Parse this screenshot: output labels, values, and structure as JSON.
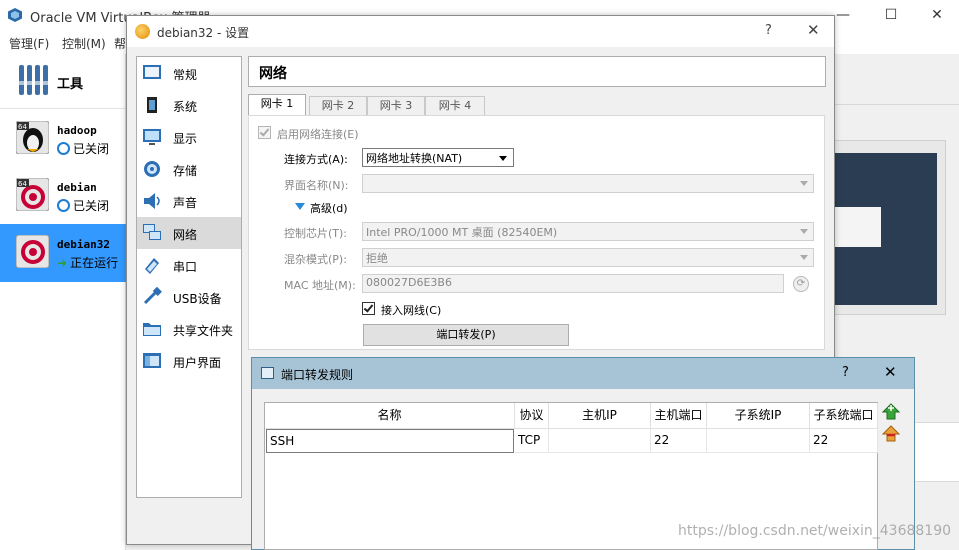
{
  "main_window": {
    "title": "Oracle VM VirtualBox 管理器",
    "minimize": "—",
    "maximize": "☐",
    "close": "✕",
    "menu": [
      "管理(F)",
      "控制(M)",
      "帮"
    ]
  },
  "vm_list": {
    "tools_label": "工具",
    "vms": [
      {
        "name": "hadoop",
        "state": "已关闭",
        "os_badge": "64"
      },
      {
        "name": "debian",
        "state": "已关闭",
        "os_badge": "64"
      },
      {
        "name": "debian32",
        "state": "正在运行"
      }
    ]
  },
  "settings": {
    "title": "debian32 - 设置",
    "help": "?",
    "close": "✕",
    "categories": [
      "常规",
      "系统",
      "显示",
      "存储",
      "声音",
      "网络",
      "串口",
      "USB设备",
      "共享文件夹",
      "用户界面"
    ],
    "selected_category": "网络",
    "section_title": "网络",
    "tabs": [
      "网卡 1",
      "网卡 2",
      "网卡 3",
      "网卡 4"
    ],
    "active_tab": "网卡 1",
    "enable_network": "启用网络连接(E)",
    "attachment_label": "连接方式(A):",
    "attachment_value": "网络地址转换(NAT)",
    "interface_name_label": "界面名称(N):",
    "advanced_label": "高级(d)",
    "adapter_type_label": "控制芯片(T):",
    "adapter_type_value": "Intel PRO/1000 MT 桌面 (82540EM)",
    "promisc_label": "混杂模式(P):",
    "promisc_value": "拒绝",
    "mac_label": "MAC 地址(M):",
    "mac_value": "080027D6E3B6",
    "cable_connected": "接入网线(C)",
    "port_forward_button": "端口转发(P)"
  },
  "port_forwarding": {
    "title": "端口转发规则",
    "help": "?",
    "close": "✕",
    "columns": [
      "名称",
      "协议",
      "主机IP",
      "主机端口",
      "子系统IP",
      "子系统端口"
    ],
    "rows": [
      {
        "name": "SSH",
        "protocol": "TCP",
        "host_ip": "",
        "host_port": "22",
        "guest_ip": "",
        "guest_port": "22"
      }
    ]
  },
  "watermark": "https://blog.csdn.net/weixin_43688190",
  "colors": {
    "selection": "#3399ff",
    "dialog_title": "#a7c4d6",
    "accent_icon": "#1c7dd6"
  }
}
